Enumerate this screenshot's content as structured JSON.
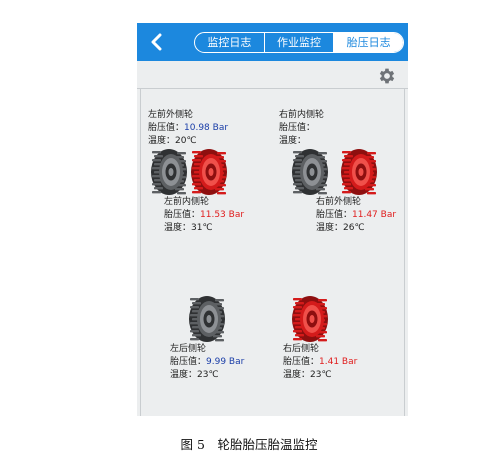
{
  "header": {
    "tabs": [
      "监控日志",
      "作业监控",
      "胎压日志"
    ],
    "active_tab": 2
  },
  "labels": {
    "pressure": "胎压值：",
    "temperature": "温度："
  },
  "tires": {
    "front_left_outer": {
      "name": "左前外侧轮",
      "pressure": "10.98 Bar",
      "temperature": "20℃",
      "status": "normal"
    },
    "front_right_inner": {
      "name": "右前内侧轮",
      "pressure": "",
      "temperature": "",
      "status": "normal"
    },
    "front_left_inner": {
      "name": "左前内侧轮",
      "pressure": "11.53 Bar",
      "temperature": "31℃",
      "status": "alarm"
    },
    "front_right_outer": {
      "name": "右前外侧轮",
      "pressure": "11.47 Bar",
      "temperature": "26℃",
      "status": "alarm"
    },
    "rear_left": {
      "name": "左后侧轮",
      "pressure": "9.99 Bar",
      "temperature": "23℃",
      "status": "normal"
    },
    "rear_right": {
      "name": "右后侧轮",
      "pressure": "1.41 Bar",
      "temperature": "23℃",
      "status": "alarm"
    }
  },
  "caption": "图 5　轮胎胎压胎温监控",
  "colors": {
    "topbar": "#1c88de",
    "normal_value": "#1b3ea8",
    "alarm_value": "#e01d1d",
    "tire_normal": "#5d6063",
    "tire_alarm": "#d41b1b"
  }
}
